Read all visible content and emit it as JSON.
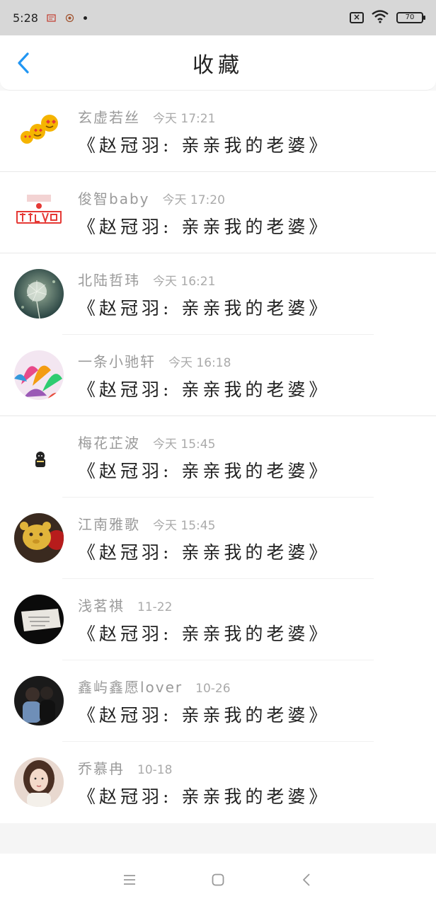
{
  "status_bar": {
    "time": "5:28",
    "battery": "70",
    "icons": [
      "message-icon",
      "app-notification-icon",
      "dot-icon",
      "no-sim-icon",
      "wifi-icon",
      "battery-icon"
    ]
  },
  "header": {
    "title": "收藏",
    "back_icon": "chevron-left-icon"
  },
  "favorites": [
    {
      "name": "玄虚若丝",
      "time": "今天 17:21",
      "content": "《赵冠羽: 亲亲我的老婆》",
      "avatar": "emoji-hearts"
    },
    {
      "name": "俊智baby",
      "time": "今天 17:20",
      "content": "《赵冠羽: 亲亲我的老婆》",
      "avatar": "text-logo"
    },
    {
      "name": "北陆哲玮",
      "time": "今天 16:21",
      "content": "《赵冠羽: 亲亲我的老婆》",
      "avatar": "dandelion"
    },
    {
      "name": "一条小驰轩",
      "time": "今天 16:18",
      "content": "《赵冠羽: 亲亲我的老婆》",
      "avatar": "balloons"
    },
    {
      "name": "梅花芷波",
      "time": "今天 15:45",
      "content": "《赵冠羽: 亲亲我的老婆》",
      "avatar": "cartoon"
    },
    {
      "name": "江南雅歌",
      "time": "今天 15:45",
      "content": "《赵冠羽: 亲亲我的老婆》",
      "avatar": "plush"
    },
    {
      "name": "浅茗祺",
      "time": "11-22",
      "content": "《赵冠羽: 亲亲我的老婆》",
      "avatar": "note"
    },
    {
      "name": "鑫屿鑫愿lover",
      "time": "10-26",
      "content": "《赵冠羽: 亲亲我的老婆》",
      "avatar": "couple"
    },
    {
      "name": "乔慕冉",
      "time": "10-18",
      "content": "《赵冠羽: 亲亲我的老婆》",
      "avatar": "girl"
    }
  ],
  "nav_bar": {
    "buttons": [
      "menu-icon",
      "home-square-icon",
      "back-triangle-icon"
    ]
  },
  "colors": {
    "accent": "#2196f3",
    "name_text": "#9a9a9a",
    "content_text": "#222222"
  }
}
